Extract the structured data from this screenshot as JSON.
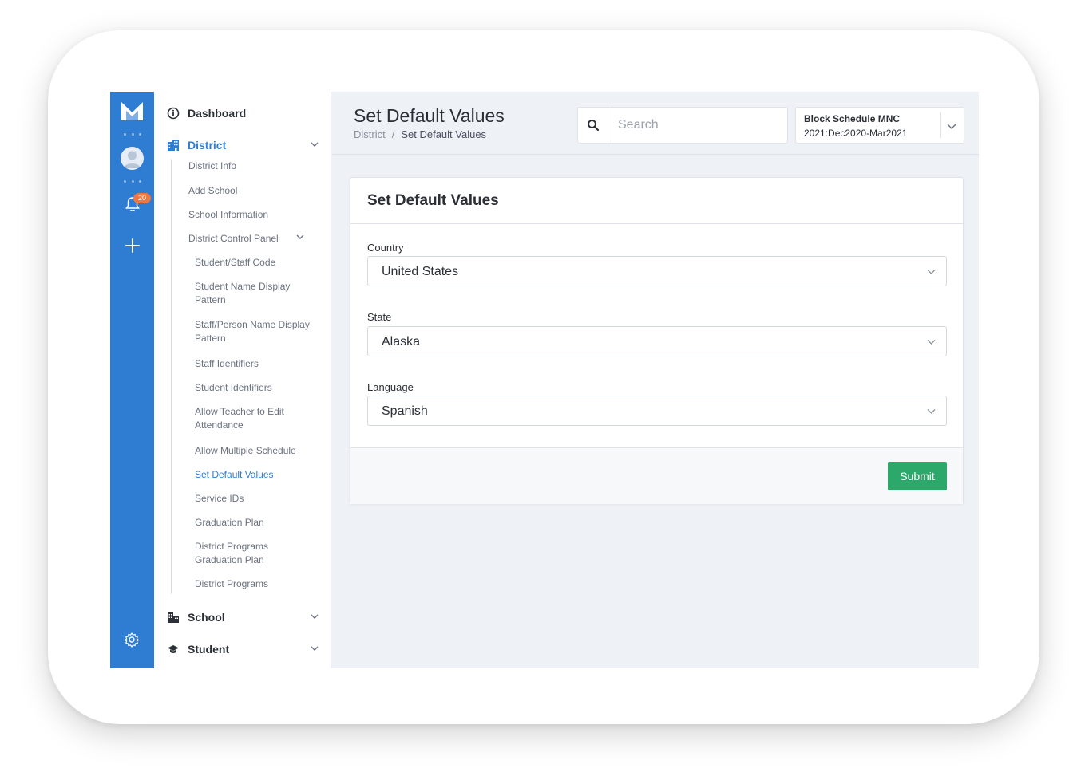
{
  "rail": {
    "notification_count": "20",
    "accent": "#2f7cd3",
    "badge_color": "#f0783f"
  },
  "sidebar": {
    "dashboard": "Dashboard",
    "district": "District",
    "school": "School",
    "student": "Student",
    "district_items": [
      "District Info",
      "Add School",
      "School Information",
      "District Control Panel"
    ],
    "control_panel_items": [
      "Student/Staff Code",
      "Student Name Display Pattern",
      "Staff/Person Name Display Pattern",
      "Staff Identifiers",
      "Student Identifiers",
      "Allow Teacher to Edit Attendance",
      "Allow Multiple Schedule",
      "Set Default Values",
      "Service IDs",
      "Graduation Plan",
      "District Programs Graduation Plan",
      "District Programs"
    ]
  },
  "header": {
    "title": "Set Default Values",
    "breadcrumb_parent": "District",
    "breadcrumb_sep": "/",
    "breadcrumb_current": "Set Default Values",
    "search_placeholder": "Search",
    "schedule_name": "Block Schedule MNC",
    "schedule_period": "2021:Dec2020-Mar2021"
  },
  "form": {
    "title": "Set Default Values",
    "country_label": "Country",
    "country_value": "United States",
    "state_label": "State",
    "state_value": "Alaska",
    "language_label": "Language",
    "language_value": "Spanish",
    "submit_label": "Submit",
    "submit_color": "#2ba86a"
  }
}
